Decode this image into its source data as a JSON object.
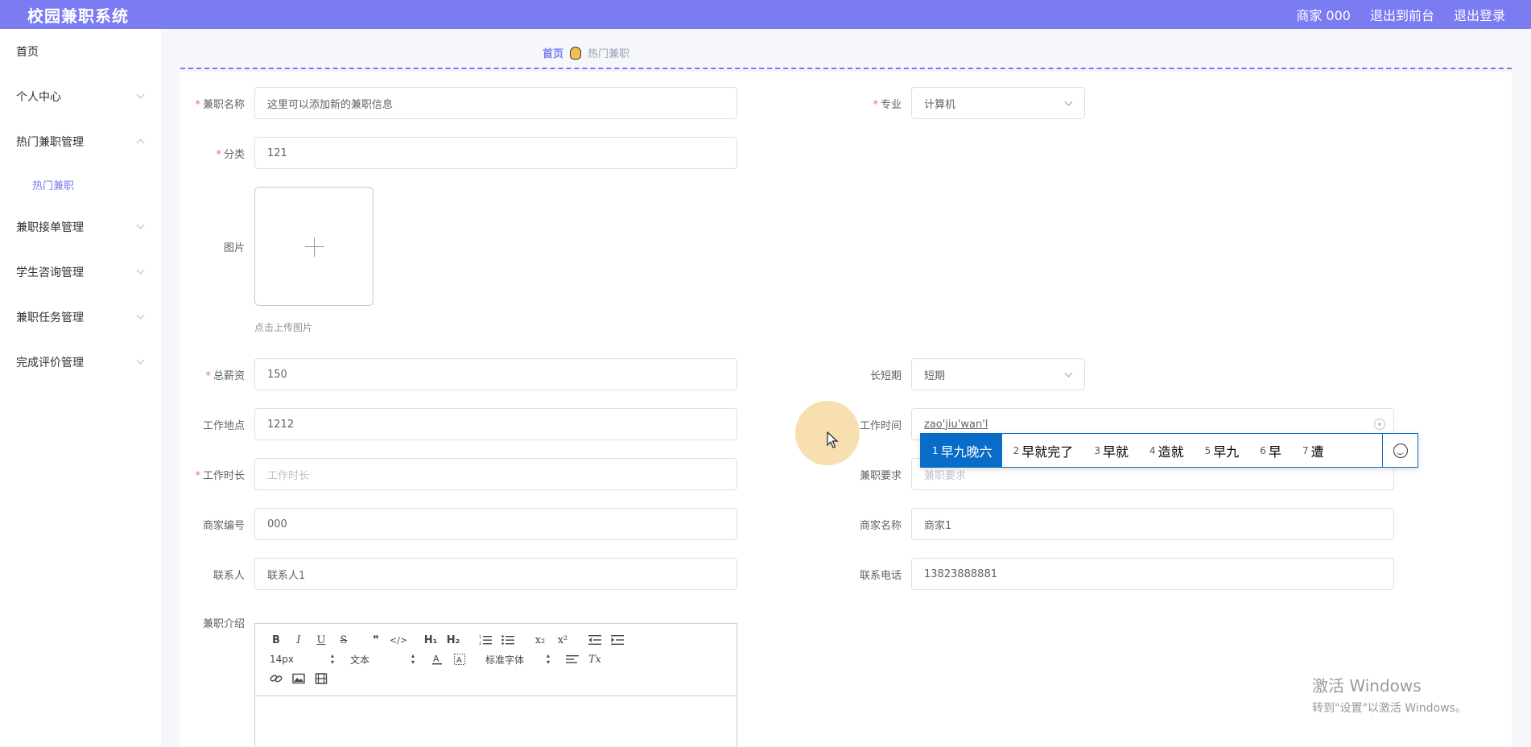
{
  "header": {
    "title": "校园兼职系统",
    "user": "商家 000",
    "to_front": "退出到前台",
    "logout": "退出登录",
    "color": "#7b7bf2"
  },
  "sidebar": {
    "items": [
      {
        "label": "首页"
      },
      {
        "label": "个人中心"
      },
      {
        "label": "热门兼职管理"
      },
      {
        "label": "热门兼职"
      },
      {
        "label": "兼职接单管理"
      },
      {
        "label": "学生咨询管理"
      },
      {
        "label": "兼职任务管理"
      },
      {
        "label": "完成评价管理"
      }
    ]
  },
  "breadcrumb": {
    "home": "首页",
    "current": "热门兼职"
  },
  "form": {
    "name": {
      "label": "兼职名称",
      "value": "这里可以添加新的兼职信息"
    },
    "major": {
      "label": "专业",
      "value": "计算机"
    },
    "category": {
      "label": "分类",
      "value": "121"
    },
    "image": {
      "label": "图片",
      "hint": "点击上传图片"
    },
    "salary": {
      "label": "总薪资",
      "value": "150"
    },
    "term": {
      "label": "长短期",
      "value": "短期"
    },
    "location": {
      "label": "工作地点",
      "value": "1212"
    },
    "work_time": {
      "label": "工作时间",
      "value": "zao'jiu'wan'l"
    },
    "duration": {
      "label": "工作时长",
      "placeholder": "工作时长"
    },
    "requirement": {
      "label": "兼职要求",
      "placeholder": "兼职要求"
    },
    "merchant_id": {
      "label": "商家编号",
      "value": "000"
    },
    "merchant_name": {
      "label": "商家名称",
      "value": "商家1"
    },
    "contact": {
      "label": "联系人",
      "value": "联系人1"
    },
    "phone": {
      "label": "联系电话",
      "value": "13823888881"
    },
    "intro": {
      "label": "兼职介绍"
    }
  },
  "editor": {
    "font_size": "14px",
    "text_type": "文本",
    "font_family": "标准字体",
    "buttons": {
      "bold": "B",
      "italic": "I",
      "underline": "U",
      "strike": "S",
      "quote": "❞",
      "code": "</>",
      "h1": "H₁",
      "h2": "H₂",
      "sub": "x₂",
      "sup": "x²",
      "clean": "Tx"
    }
  },
  "ime": {
    "candidates": [
      {
        "n": "1",
        "text": "早九晚六"
      },
      {
        "n": "2",
        "text": "早就完了"
      },
      {
        "n": "3",
        "text": "早就"
      },
      {
        "n": "4",
        "text": "造就"
      },
      {
        "n": "5",
        "text": "早九"
      },
      {
        "n": "6",
        "text": "早"
      },
      {
        "n": "7",
        "text": "遭"
      }
    ],
    "icon": "smiley-icon"
  },
  "watermark": {
    "line1": "激活 Windows",
    "line2": "转到\"设置\"以激活 Windows。"
  }
}
